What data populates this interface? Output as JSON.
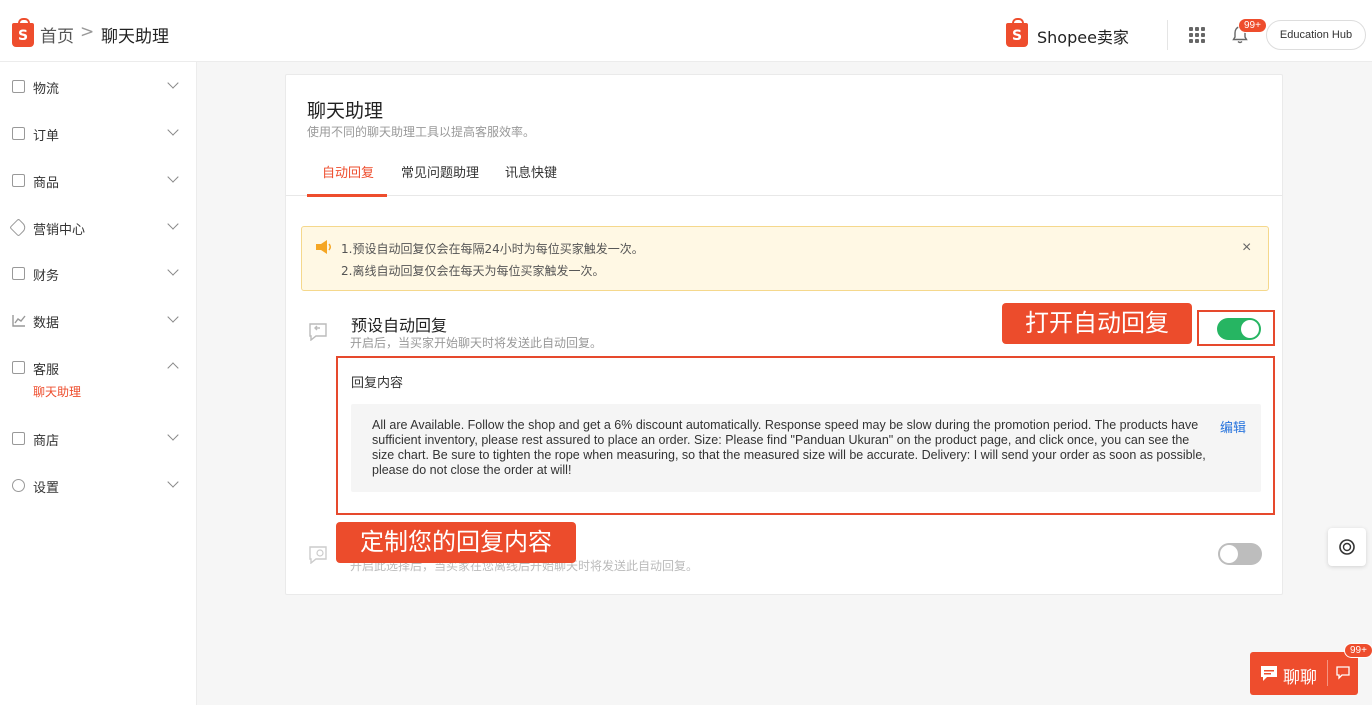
{
  "header": {
    "breadcrumb_home": "首页",
    "breadcrumb_sep": ">",
    "breadcrumb_current": "聊天助理",
    "logo_letter": "S",
    "brand": "Shopee卖家",
    "notification_badge": "99+",
    "education_hub": "Education Hub"
  },
  "sidebar": {
    "items": [
      {
        "label": "物流",
        "icon": "package-icon"
      },
      {
        "label": "订单",
        "icon": "clipboard-icon"
      },
      {
        "label": "商品",
        "icon": "bag-icon"
      },
      {
        "label": "营销中心",
        "icon": "tag-icon"
      },
      {
        "label": "财务",
        "icon": "wallet-icon"
      },
      {
        "label": "数据",
        "icon": "chart-icon"
      },
      {
        "label": "客服",
        "icon": "chat-icon"
      },
      {
        "label": "商店",
        "icon": "store-icon"
      },
      {
        "label": "设置",
        "icon": "gear-icon"
      }
    ],
    "active_sub": "聊天助理"
  },
  "page": {
    "title": "聊天助理",
    "subtitle": "使用不同的聊天助理工具以提高客服效率。",
    "tabs": [
      "自动回复",
      "常见问题助理",
      "讯息快键"
    ],
    "active_tab": 0
  },
  "notice": {
    "line1": "1.预设自动回复仅会在每隔24小时为每位买家触发一次。",
    "line2": "2.离线自动回复仅会在每天为每位买家触发一次。",
    "close": "×"
  },
  "default_reply": {
    "title": "预设自动回复",
    "description": "开启后，当买家开始聊天时将发送此自动回复。",
    "enabled": true,
    "content_label": "回复内容",
    "content": "All are Available. Follow the shop and get a 6% discount automatically. Response speed may be slow during the promotion period. The products have sufficient inventory, please rest assured to place an order. Size: Please find \"Panduan Ukuran\" on the product page, and click once, you can see the size chart. Be sure to tighten the rope when measuring, so that the measured size will be accurate. Delivery: I will send your order as soon as possible, please do not close the order at will!",
    "edit_label": "编辑"
  },
  "offline_reply": {
    "description": "开启此选择后，当买家在您离线后开始聊天时将发送此自动回复。",
    "enabled": false
  },
  "annotations": {
    "toggle_callout": "打开自动回复",
    "content_callout": "定制您的回复内容"
  },
  "chat_widget": {
    "label": "聊聊",
    "badge": "99+"
  },
  "colors": {
    "brand": "#ee4d2d",
    "toggle_on": "#26b562",
    "link": "#2673dd",
    "notice_bg": "#fff8e4"
  }
}
